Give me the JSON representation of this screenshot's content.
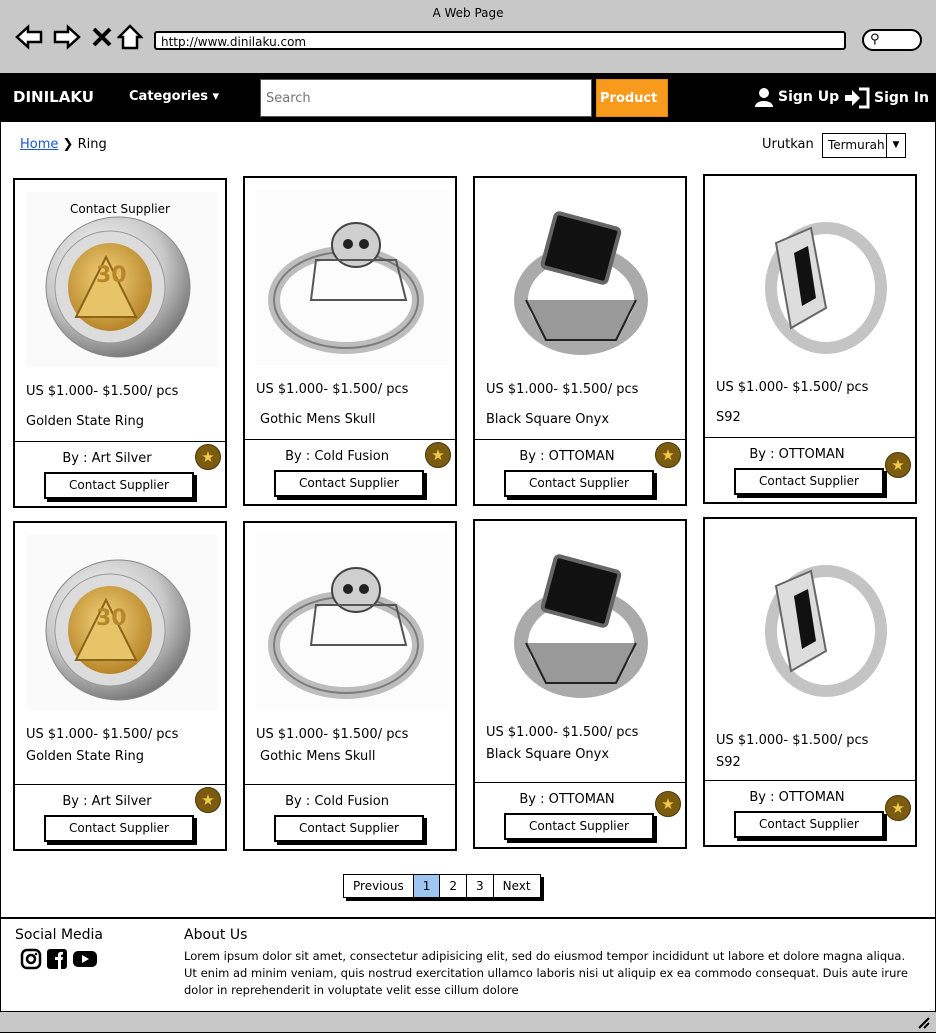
{
  "browser": {
    "window_title": "A Web Page",
    "url": "http://www.dinilaku.com"
  },
  "nav": {
    "brand": "DINILAKU",
    "categories_label": "Categories",
    "search_placeholder": "Search",
    "product_label": "Product",
    "signup_label": "Sign Up",
    "signin_label": "Sign In"
  },
  "breadcrumb": {
    "home": "Home",
    "current": "Ring"
  },
  "sort": {
    "label": "Urutkan",
    "value": "Termurah"
  },
  "products": [
    {
      "price": "US $1.000- $1.500/ pcs",
      "name": "Golden State Ring",
      "by": "By : Art Silver",
      "button": "Contact Supplier",
      "image": "golden-ring",
      "overlay": "Contact Supplier"
    },
    {
      "price": "US $1.000- $1.500/ pcs",
      "name": "Gothic Mens Skull",
      "by": "By : Cold Fusion",
      "button": "Contact Supplier",
      "image": "skull-ring"
    },
    {
      "price": "US $1.000- $1.500/ pcs",
      "name": "Black Square Onyx",
      "by": "By : OTTOMAN",
      "button": "Contact Supplier",
      "image": "onyx-ring"
    },
    {
      "price": "US $1.000- $1.500/ pcs",
      "name": "S92",
      "by": "By : OTTOMAN",
      "button": "Contact Supplier",
      "image": "silver-ring"
    },
    {
      "price": "US $1.000- $1.500/ pcs",
      "name": "Golden State Ring",
      "by": "By : Art Silver",
      "button": "Contact Supplier",
      "image": "golden-ring"
    },
    {
      "price": "US $1.000- $1.500/ pcs",
      "name": "Gothic Mens Skull",
      "by": "By : Cold Fusion",
      "button": "Contact Supplier",
      "image": "skull-ring"
    },
    {
      "price": "US $1.000- $1.500/ pcs",
      "name": "Black Square Onyx",
      "by": "By : OTTOMAN",
      "button": "Contact Supplier",
      "image": "onyx-ring"
    },
    {
      "price": "US $1.000- $1.500/ pcs",
      "name": "S92",
      "by": "By : OTTOMAN",
      "button": "Contact Supplier",
      "image": "silver-ring"
    }
  ],
  "pagination": {
    "previous": "Previous",
    "pages": [
      "1",
      "2",
      "3"
    ],
    "current": "1",
    "next": "Next"
  },
  "footer": {
    "social_title": "Social Media",
    "social_icons": [
      "instagram-icon",
      "facebook-icon",
      "youtube-icon"
    ],
    "about_title": "About Us",
    "about_text": "Lorem ipsum dolor sit amet, consectetur adipisicing elit, sed do eiusmod tempor incididunt ut labore et dolore magna aliqua. Ut enim ad minim veniam, quis nostrud exercitation ullamco laboris nisi ut aliquip ex ea commodo consequat. Duis aute irure dolor in reprehenderit in voluptate velit esse cillum dolore"
  },
  "colors": {
    "nav_bg": "#000000",
    "product_btn": "#f89a1c",
    "active_page": "#9ec6f3",
    "link": "#1a56d6",
    "star_badge": "#7a5b10"
  }
}
